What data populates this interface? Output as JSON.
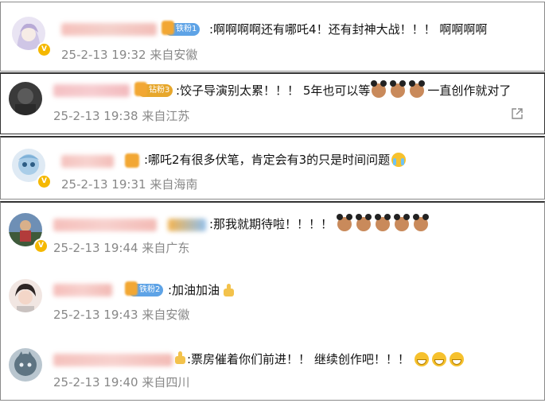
{
  "comments": [
    {
      "username": "",
      "fan_badge": "铁粉1",
      "text": ":啊啊啊啊还有哪吒4！还有封神大战！！！ 啊啊啊啊",
      "time": "25-2-13 19:32",
      "location": "来自安徽"
    },
    {
      "username": "",
      "fan_badge": "钻粉3",
      "text": ":饺子导演别太累！！！ 5年也可以等",
      "text_after": "一直创作就对了",
      "time": "25-2-13 19:38",
      "location": "来自江苏"
    },
    {
      "username": "",
      "text": ":哪吒2有很多伏笔，肯定会有3的只是时间问题",
      "time": "25-2-13 19:31",
      "location": "来自海南"
    },
    {
      "username": "",
      "text": ":那我就期待啦！！！！",
      "time": "25-2-13 19:44",
      "location": "来自广东"
    },
    {
      "username": "",
      "fan_badge": "铁粉2",
      "text": ":加油加油",
      "time": "25-2-13 19:43",
      "location": "来自安徽"
    },
    {
      "username": "",
      "text": ":票房催着你们前进！！ 继续创作吧！！！",
      "time": "25-2-13 19:40",
      "location": "来自四川"
    }
  ],
  "icons": {
    "verified": "vip-badge-icon",
    "share": "share-icon",
    "emoji_nezha": "nezha-emoji-icon",
    "emoji_grin": "grin-emoji-icon",
    "emoji_cry": "cry-emoji-icon",
    "emoji_thumb": "thumbs-up-emoji-icon"
  },
  "colors": {
    "text": "#111111",
    "meta": "#888888",
    "verified": "#f5b800",
    "badge_iron": "#5ea3e6",
    "badge_diamond": "#e7a72c"
  }
}
